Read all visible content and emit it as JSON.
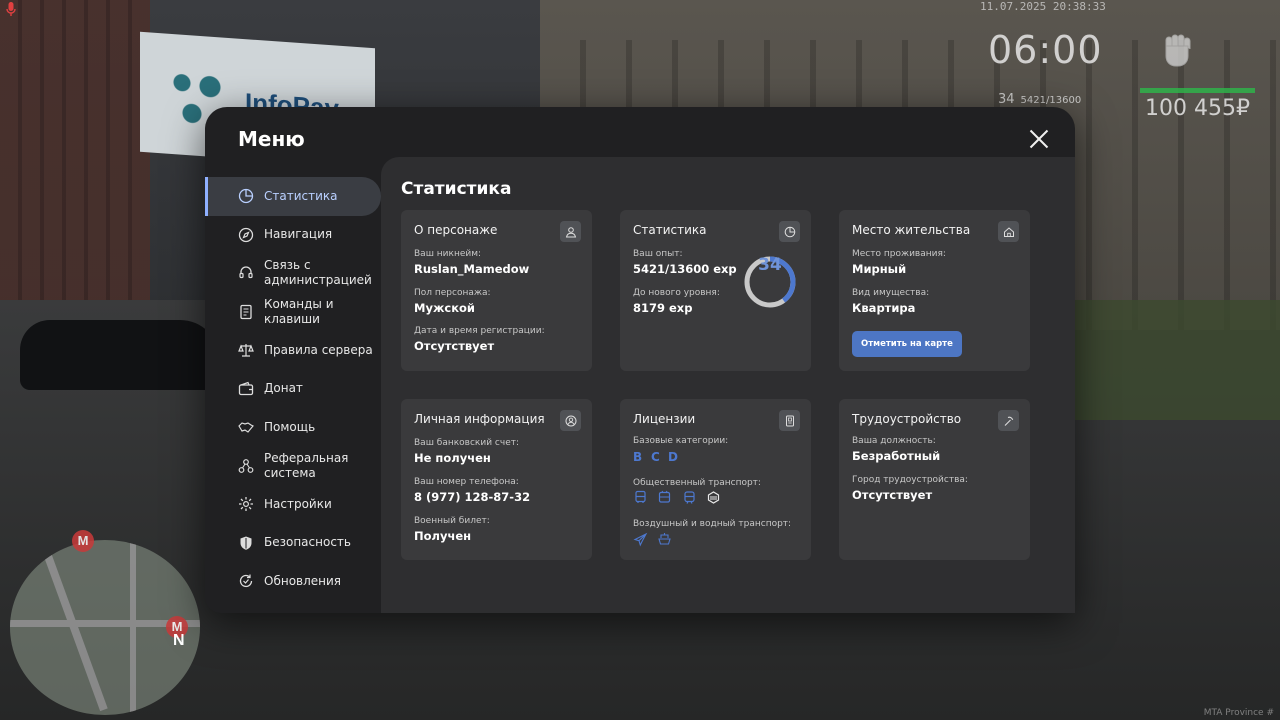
{
  "hud": {
    "date": "11.07.2025 20:38:33",
    "time": "06:00",
    "level": "34",
    "xp": "5421/13600",
    "money": "100 455₽",
    "watermark": "MTA Province #"
  },
  "billboard": {
    "logo": "InfoPay"
  },
  "menu": {
    "title": "Меню",
    "close_icon": "close-icon"
  },
  "sidebar": {
    "items": [
      {
        "label": "Статистика",
        "icon": "pie-chart-icon",
        "active": true
      },
      {
        "label": "Навигация",
        "icon": "compass-icon"
      },
      {
        "label": "Связь с администрацией",
        "icon": "headset-icon"
      },
      {
        "label": "Команды и клавиши",
        "icon": "document-icon"
      },
      {
        "label": "Правила сервера",
        "icon": "scales-icon"
      },
      {
        "label": "Донат",
        "icon": "wallet-icon"
      },
      {
        "label": "Помощь",
        "icon": "handshake-icon"
      },
      {
        "label": "Реферальная система",
        "icon": "referral-icon"
      },
      {
        "label": "Настройки",
        "icon": "gear-icon"
      },
      {
        "label": "Безопасность",
        "icon": "shield-icon"
      },
      {
        "label": "Обновления",
        "icon": "refresh-check-icon"
      }
    ]
  },
  "content": {
    "title": "Статистика",
    "character": {
      "title": "О персонаже",
      "nick_label": "Ваш никнейм:",
      "nick_value": "Ruslan_Mamedow",
      "gender_label": "Пол персонажа:",
      "gender_value": "Мужской",
      "reg_label": "Дата и время регистрации:",
      "reg_value": "Отсутствует"
    },
    "stats": {
      "title": "Статистика",
      "exp_label": "Ваш опыт:",
      "exp_value": "5421/13600 exp",
      "next_label": "До нового уровня:",
      "next_value": "8179 exp",
      "level": "34",
      "progress_fraction": 0.3986
    },
    "residence": {
      "title": "Место жительства",
      "place_label": "Место проживания:",
      "place_value": "Мирный",
      "type_label": "Вид имущества:",
      "type_value": "Квартира",
      "button": "Отметить на карте"
    },
    "personal": {
      "title": "Личная информация",
      "bank_label": "Ваш банковский счет:",
      "bank_value": "Не получен",
      "phone_label": "Ваш номер телефона:",
      "phone_value": "8 (977) 128-87-32",
      "military_label": "Военный билет:",
      "military_value": "Получен"
    },
    "licenses": {
      "title": "Лицензии",
      "base_label": "Базовые категории:",
      "base_categories": [
        "B",
        "C",
        "D"
      ],
      "public_label": "Общественный транспорт:",
      "air_water_label": "Воздушный и водный транспорт:",
      "accent": "#4d78cf"
    },
    "employment": {
      "title": "Трудоустройство",
      "position_label": "Ваша должность:",
      "position_value": "Безработный",
      "city_label": "Город трудоустройства:",
      "city_value": "Отсутствует"
    }
  }
}
